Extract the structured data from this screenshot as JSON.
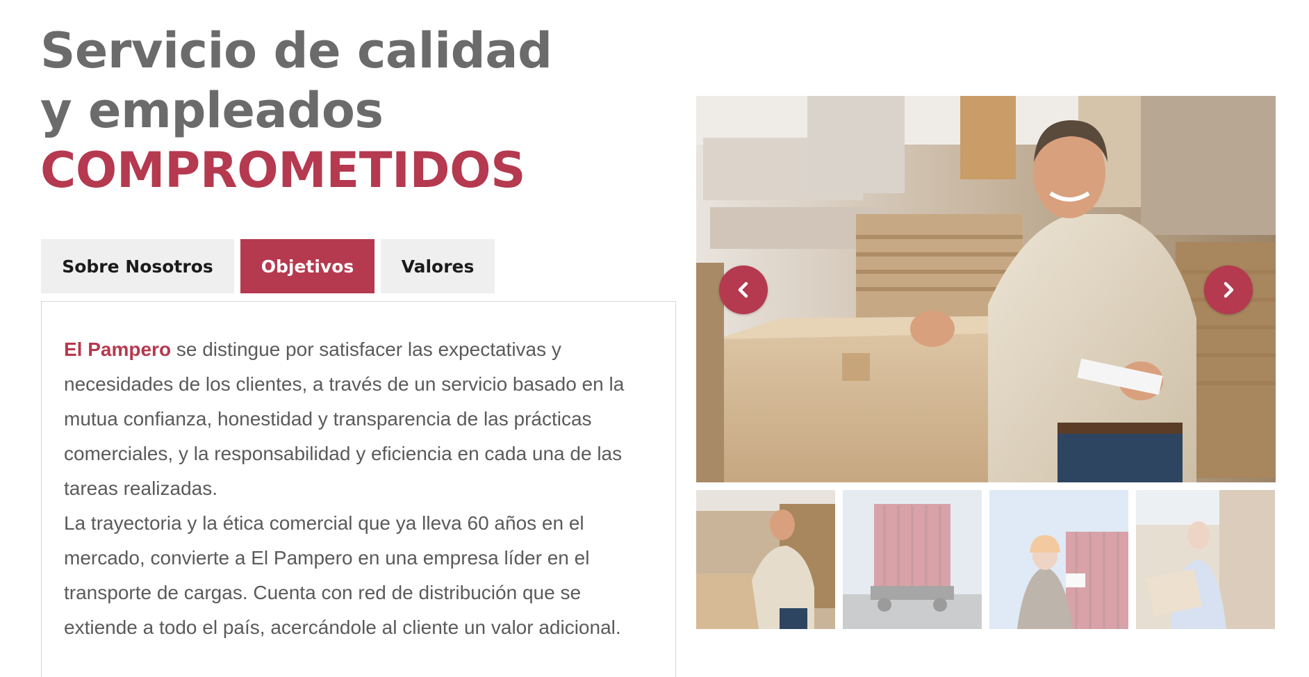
{
  "heading": {
    "line1": "Servicio de calidad",
    "line2": "y empleados",
    "line3": "COMPROMETIDOS"
  },
  "tabs": [
    {
      "label": "Sobre Nosotros",
      "active": false
    },
    {
      "label": "Objetivos",
      "active": true
    },
    {
      "label": "Valores",
      "active": false
    }
  ],
  "content": {
    "brand": "El Pampero",
    "paragraph1_rest": " se distingue por satisfacer las expectativas y necesidades de los clientes, a través de un servicio basado en la mutua confianza, honestidad y transparencia de las prácticas comerciales, y la responsabilidad y eficiencia en cada una de las tareas realizadas.",
    "paragraph2": "La trayectoria y la ética comercial que ya lleva 60 años en el mercado, convierte a El Pampero en una empresa líder en el transporte de cargas. Cuenta con red de distribución que se extiende a todo el país, acercándole al cliente un valor adicional."
  },
  "carousel": {
    "prev_icon": "chevron-left-icon",
    "next_icon": "chevron-right-icon",
    "slides": [
      "warehouse worker",
      "red cargo truck",
      "worker with hard hat",
      "man carrying box"
    ],
    "active_slide": 0
  },
  "colors": {
    "accent": "#b5394f",
    "heading_gray": "#6b6b6b",
    "body_text": "#5a5a5a",
    "tab_bg": "#efefef"
  }
}
